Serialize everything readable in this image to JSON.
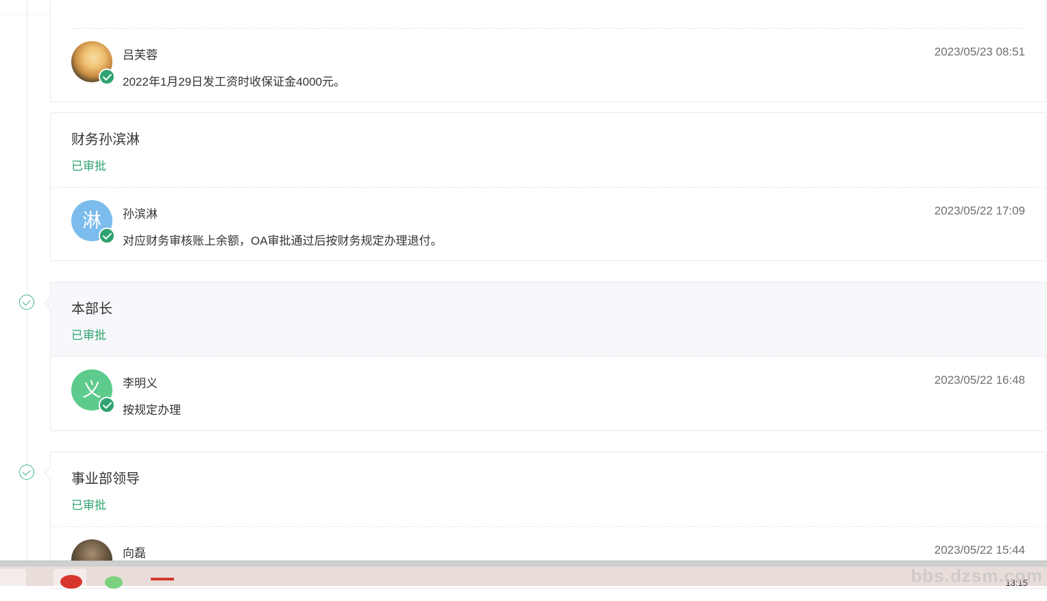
{
  "approval_flow": {
    "cards": [
      {
        "title": "",
        "status": "",
        "entries": [
          {
            "name": "吕芙蓉",
            "time": "2023/05/23 08:51",
            "comment": "2022年1月29日发工资时收保证金4000元。",
            "avatar_type": "photo-rose",
            "avatar_text": ""
          }
        ]
      },
      {
        "title": "财务孙滨淋",
        "status": "已审批",
        "entries": [
          {
            "name": "孙滨淋",
            "time": "2023/05/22 17:09",
            "comment": "对应财务审核账上余额，OA审批通过后按财务规定办理退付。",
            "avatar_type": "letter",
            "avatar_text": "淋"
          }
        ]
      },
      {
        "title": "本部长",
        "status": "已审批",
        "entries": [
          {
            "name": "李明义",
            "time": "2023/05/22 16:48",
            "comment": "按规定办理",
            "avatar_type": "letter",
            "avatar_text": "义"
          }
        ]
      },
      {
        "title": "事业部领导",
        "status": "已审批",
        "entries": [
          {
            "name": "向磊",
            "time": "2023/05/22 15:44",
            "comment": "",
            "avatar_type": "photo",
            "avatar_text": ""
          }
        ]
      }
    ]
  },
  "taskbar": {
    "clock": "13:15",
    "watermark": "bbs.dzsm.com"
  },
  "colors": {
    "approved": "#2fa36f",
    "node": "#3fb58a",
    "avatar_blue": "#7bbcec",
    "avatar_green": "#5dcb8c"
  }
}
